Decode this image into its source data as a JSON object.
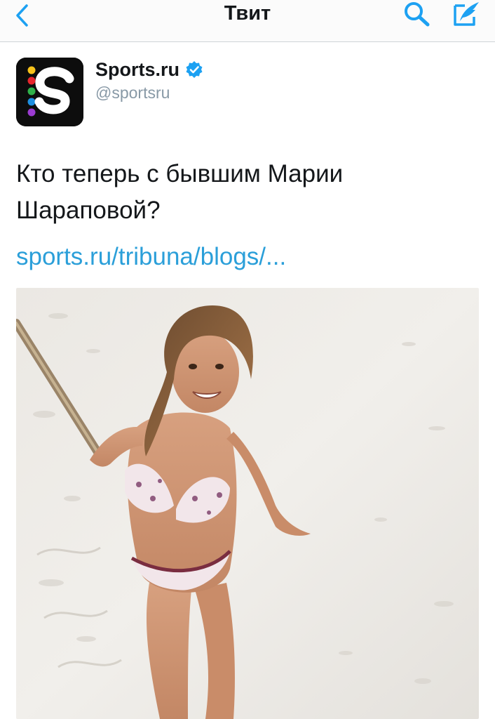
{
  "nav": {
    "title": "Твит",
    "back_icon": "chevron-left-icon",
    "search_icon": "search-icon",
    "compose_icon": "compose-tweet-icon",
    "accent_color": "#1da1f2"
  },
  "tweet": {
    "author": {
      "name": "Sports.ru",
      "handle": "@sportsru",
      "verified": true,
      "avatar_icon": "sports-ru-logo"
    },
    "text": "Кто теперь с бывшим Марии Шараповой?",
    "link": "sports.ru/tribuna/blogs/...",
    "media": {
      "kind": "photo",
      "icon": "beach-selfie-photo"
    }
  }
}
